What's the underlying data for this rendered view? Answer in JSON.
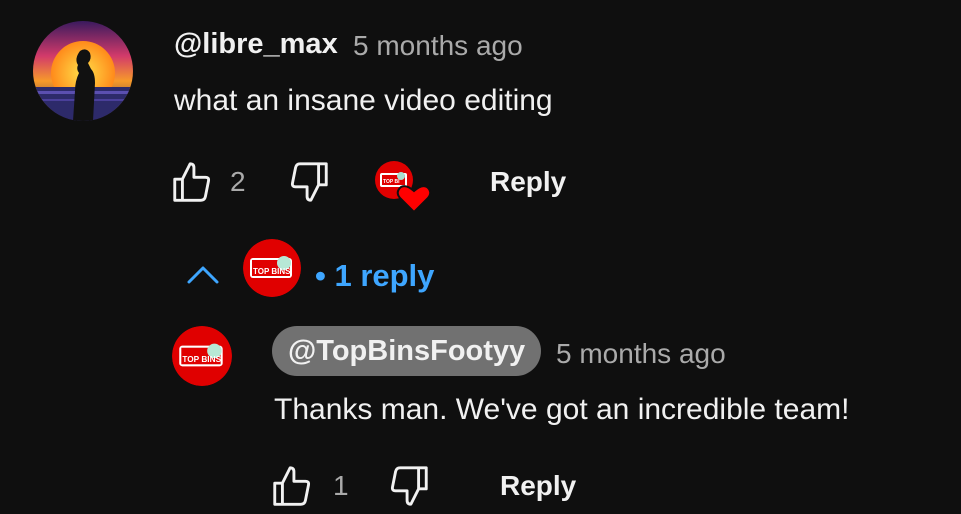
{
  "comment": {
    "author": "@libre_max",
    "time": "5 months ago",
    "text": "what an insane video editing",
    "like_count": "2",
    "reply_label": "Reply",
    "replies_toggle": "• 1 reply"
  },
  "reply": {
    "author": "@TopBinsFootyy",
    "time": "5 months ago",
    "text": "Thanks man. We've got an incredible team!",
    "like_count": "1",
    "reply_label": "Reply"
  },
  "colors": {
    "background": "#0f0f0f",
    "accent_blue": "#3ea6ff",
    "heart_red": "#ff0000"
  },
  "icons": [
    "like-icon",
    "dislike-icon",
    "heart-icon",
    "chevron-up-icon"
  ]
}
